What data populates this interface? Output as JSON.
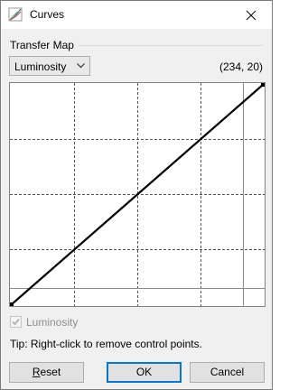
{
  "window": {
    "title": "Curves",
    "close_glyph": "close-icon"
  },
  "transfer_map": {
    "label": "Transfer Map",
    "mode_selected": "Luminosity",
    "coords_readout": "(234, 20)"
  },
  "curve": {
    "points": [
      [
        0,
        0
      ],
      [
        255,
        255
      ]
    ],
    "line_color": "#000000",
    "grid_divisions": 4
  },
  "luminosity_checkbox": {
    "label": "Luminosity",
    "checked": true,
    "enabled": false
  },
  "tip": "Tip: Right-click to remove control points.",
  "buttons": {
    "reset": "Reset",
    "ok": "OK",
    "cancel": "Cancel"
  }
}
